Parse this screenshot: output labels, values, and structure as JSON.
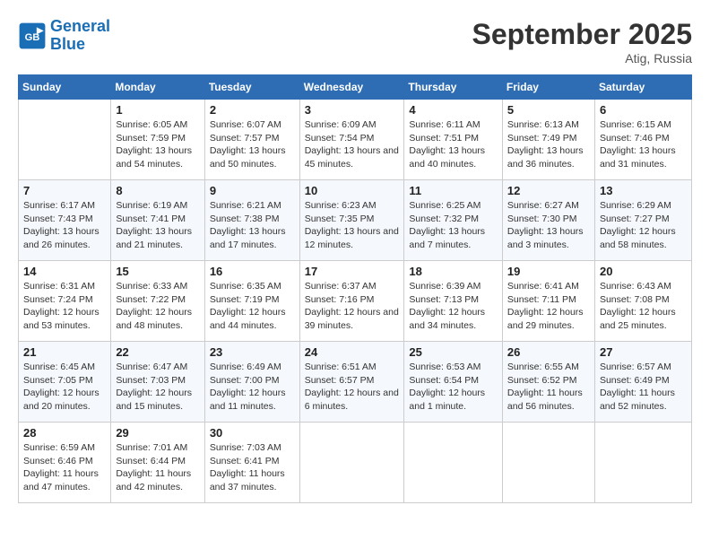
{
  "header": {
    "logo_line1": "General",
    "logo_line2": "Blue",
    "month": "September 2025",
    "location": "Atig, Russia"
  },
  "weekdays": [
    "Sunday",
    "Monday",
    "Tuesday",
    "Wednesday",
    "Thursday",
    "Friday",
    "Saturday"
  ],
  "weeks": [
    [
      null,
      {
        "day": "1",
        "sunrise": "6:05 AM",
        "sunset": "7:59 PM",
        "daylight": "13 hours and 54 minutes."
      },
      {
        "day": "2",
        "sunrise": "6:07 AM",
        "sunset": "7:57 PM",
        "daylight": "13 hours and 50 minutes."
      },
      {
        "day": "3",
        "sunrise": "6:09 AM",
        "sunset": "7:54 PM",
        "daylight": "13 hours and 45 minutes."
      },
      {
        "day": "4",
        "sunrise": "6:11 AM",
        "sunset": "7:51 PM",
        "daylight": "13 hours and 40 minutes."
      },
      {
        "day": "5",
        "sunrise": "6:13 AM",
        "sunset": "7:49 PM",
        "daylight": "13 hours and 36 minutes."
      },
      {
        "day": "6",
        "sunrise": "6:15 AM",
        "sunset": "7:46 PM",
        "daylight": "13 hours and 31 minutes."
      }
    ],
    [
      {
        "day": "7",
        "sunrise": "6:17 AM",
        "sunset": "7:43 PM",
        "daylight": "13 hours and 26 minutes."
      },
      {
        "day": "8",
        "sunrise": "6:19 AM",
        "sunset": "7:41 PM",
        "daylight": "13 hours and 21 minutes."
      },
      {
        "day": "9",
        "sunrise": "6:21 AM",
        "sunset": "7:38 PM",
        "daylight": "13 hours and 17 minutes."
      },
      {
        "day": "10",
        "sunrise": "6:23 AM",
        "sunset": "7:35 PM",
        "daylight": "13 hours and 12 minutes."
      },
      {
        "day": "11",
        "sunrise": "6:25 AM",
        "sunset": "7:32 PM",
        "daylight": "13 hours and 7 minutes."
      },
      {
        "day": "12",
        "sunrise": "6:27 AM",
        "sunset": "7:30 PM",
        "daylight": "13 hours and 3 minutes."
      },
      {
        "day": "13",
        "sunrise": "6:29 AM",
        "sunset": "7:27 PM",
        "daylight": "12 hours and 58 minutes."
      }
    ],
    [
      {
        "day": "14",
        "sunrise": "6:31 AM",
        "sunset": "7:24 PM",
        "daylight": "12 hours and 53 minutes."
      },
      {
        "day": "15",
        "sunrise": "6:33 AM",
        "sunset": "7:22 PM",
        "daylight": "12 hours and 48 minutes."
      },
      {
        "day": "16",
        "sunrise": "6:35 AM",
        "sunset": "7:19 PM",
        "daylight": "12 hours and 44 minutes."
      },
      {
        "day": "17",
        "sunrise": "6:37 AM",
        "sunset": "7:16 PM",
        "daylight": "12 hours and 39 minutes."
      },
      {
        "day": "18",
        "sunrise": "6:39 AM",
        "sunset": "7:13 PM",
        "daylight": "12 hours and 34 minutes."
      },
      {
        "day": "19",
        "sunrise": "6:41 AM",
        "sunset": "7:11 PM",
        "daylight": "12 hours and 29 minutes."
      },
      {
        "day": "20",
        "sunrise": "6:43 AM",
        "sunset": "7:08 PM",
        "daylight": "12 hours and 25 minutes."
      }
    ],
    [
      {
        "day": "21",
        "sunrise": "6:45 AM",
        "sunset": "7:05 PM",
        "daylight": "12 hours and 20 minutes."
      },
      {
        "day": "22",
        "sunrise": "6:47 AM",
        "sunset": "7:03 PM",
        "daylight": "12 hours and 15 minutes."
      },
      {
        "day": "23",
        "sunrise": "6:49 AM",
        "sunset": "7:00 PM",
        "daylight": "12 hours and 11 minutes."
      },
      {
        "day": "24",
        "sunrise": "6:51 AM",
        "sunset": "6:57 PM",
        "daylight": "12 hours and 6 minutes."
      },
      {
        "day": "25",
        "sunrise": "6:53 AM",
        "sunset": "6:54 PM",
        "daylight": "12 hours and 1 minute."
      },
      {
        "day": "26",
        "sunrise": "6:55 AM",
        "sunset": "6:52 PM",
        "daylight": "11 hours and 56 minutes."
      },
      {
        "day": "27",
        "sunrise": "6:57 AM",
        "sunset": "6:49 PM",
        "daylight": "11 hours and 52 minutes."
      }
    ],
    [
      {
        "day": "28",
        "sunrise": "6:59 AM",
        "sunset": "6:46 PM",
        "daylight": "11 hours and 47 minutes."
      },
      {
        "day": "29",
        "sunrise": "7:01 AM",
        "sunset": "6:44 PM",
        "daylight": "11 hours and 42 minutes."
      },
      {
        "day": "30",
        "sunrise": "7:03 AM",
        "sunset": "6:41 PM",
        "daylight": "11 hours and 37 minutes."
      },
      null,
      null,
      null,
      null
    ]
  ]
}
